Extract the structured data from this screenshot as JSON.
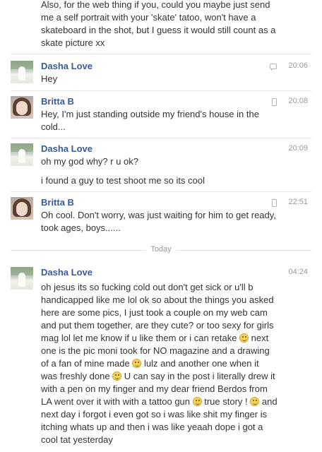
{
  "top_message": "Also, for the web thing if you, could you maybe just send me a self portrait with your 'skate' tatoo, won't have a skateboard in the shot, but I guess it would still count as a skate picture xx",
  "divider_label": "Today",
  "messages": [
    {
      "sender": "Dasha Love",
      "time": "20:06",
      "source_icon": "chat-icon",
      "text": "Hey"
    },
    {
      "sender": "Britta B",
      "time": "20:08",
      "source_icon": "phone-icon",
      "text": "Hey, I'm just standing outside my friend's house in the cold..."
    },
    {
      "sender": "Dasha Love",
      "time": "20:09",
      "source_icon": "",
      "text": "oh my god why? r u ok?",
      "text2": "i found a guy to test shoot me so its cool"
    },
    {
      "sender": "Britta B",
      "time": "22:51",
      "source_icon": "phone-icon",
      "text": "Oh cool. Don't worry, was just waiting for him to get ready, took ages, boys......"
    },
    {
      "sender": "Dasha Love",
      "time": "04:24",
      "source_icon": "",
      "segments": [
        "oh jesus its so fucking cold out don't get sick or u'll b handicapped like me lol ok so about the things you asked here are some pics, I just took a couple on my web cam and put them together, are they cute? or too sexy for girls mag lol let me know if u like them or i can retake ",
        " next one is the pic moni took for NO magazine and a drawing of a fan of mine made ",
        " lulz and another one when it was freshly done ",
        " U can say in the post i literally drew it with a pen on my finger and my dear friend Berdos from LA went over it with with a tattoo gun ",
        " true story ! ",
        " and next day i forgot i even got so i was like shit my finger is itching whats up and then i was like yeaah dope i got a cool tat yesterday"
      ]
    }
  ]
}
